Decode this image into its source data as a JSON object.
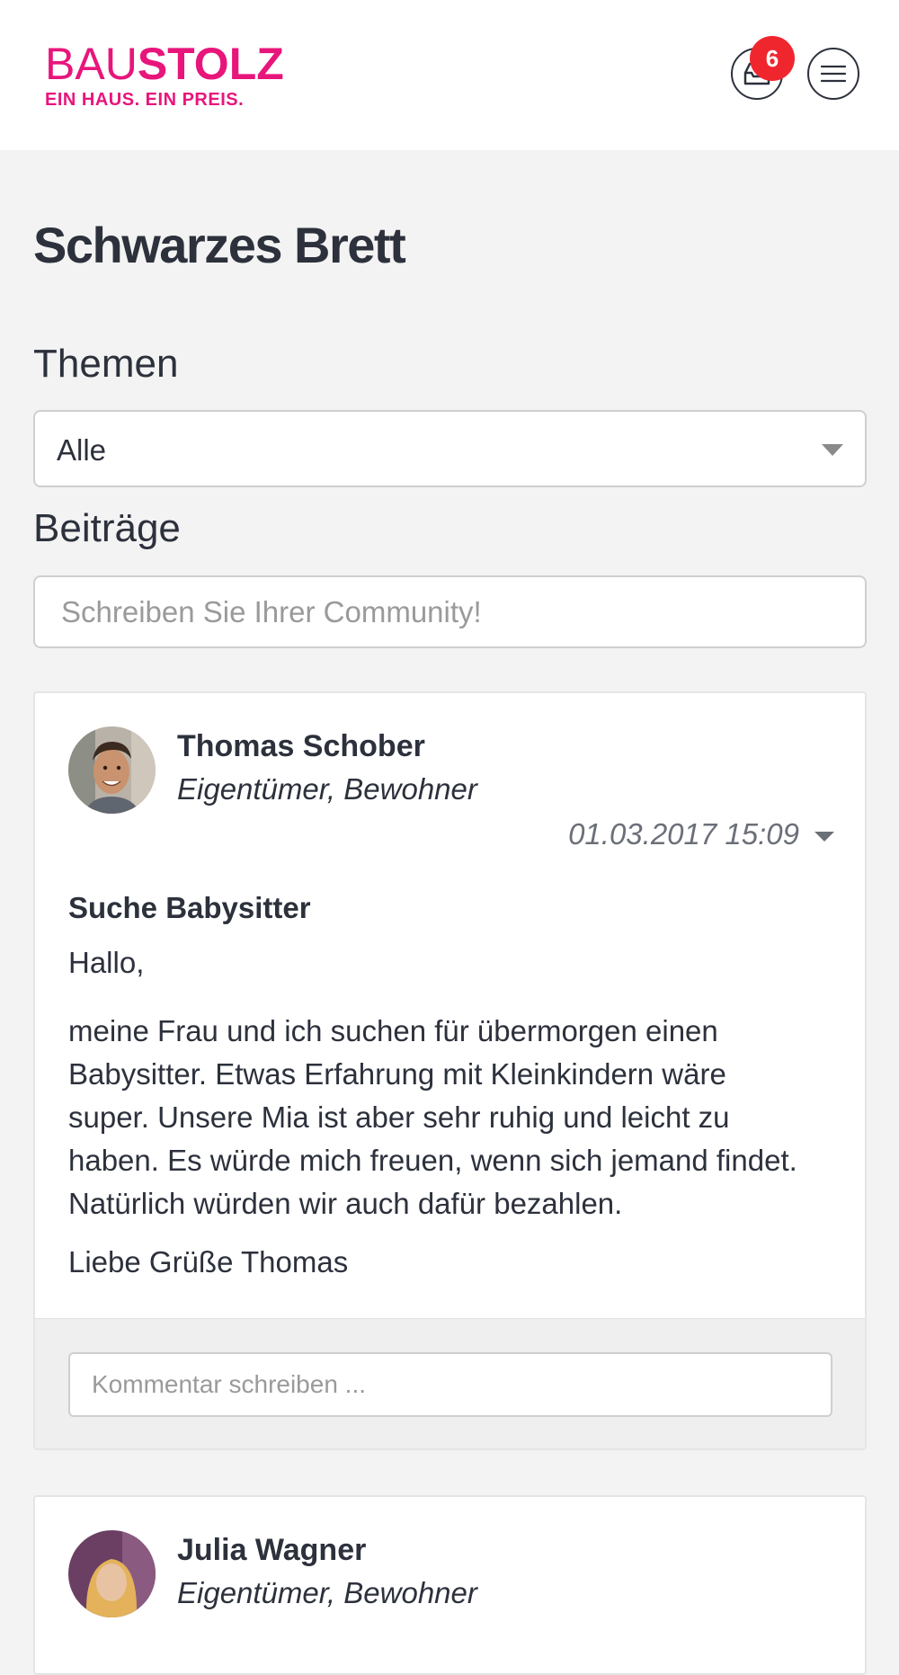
{
  "brand": {
    "logo_part1": "BAU",
    "logo_part2": "STOLZ",
    "tagline": "EIN HAUS. EIN PREIS.",
    "accent_color": "#e8157b"
  },
  "header": {
    "inbox_icon": "inbox-icon",
    "menu_icon": "hamburger-menu-icon",
    "notification_count": "6"
  },
  "page": {
    "title": "Schwarzes Brett"
  },
  "filters": {
    "topics_label": "Themen",
    "topics_selected": "Alle"
  },
  "posts_section": {
    "label": "Beiträge",
    "input_placeholder": "Schreiben Sie Ihrer Community!"
  },
  "posts": [
    {
      "author": "Thomas Schober",
      "role": "Eigentümer, Bewohner",
      "date": "01.03.2017 15:09",
      "title": "Suche Babysitter",
      "greeting": "Hallo,",
      "body": "meine Frau und ich suchen für übermorgen einen Babysitter. Etwas Erfahrung mit Kleinkindern wäre super. Unsere Mia ist aber sehr ruhig und leicht zu haben. Es würde mich freuen, wenn sich jemand findet. Natürlich würden wir auch dafür bezahlen.",
      "signoff": "Liebe Grüße Thomas",
      "comment_placeholder": "Kommentar schreiben ..."
    },
    {
      "author": "Julia Wagner",
      "role": "Eigentümer, Bewohner"
    }
  ]
}
